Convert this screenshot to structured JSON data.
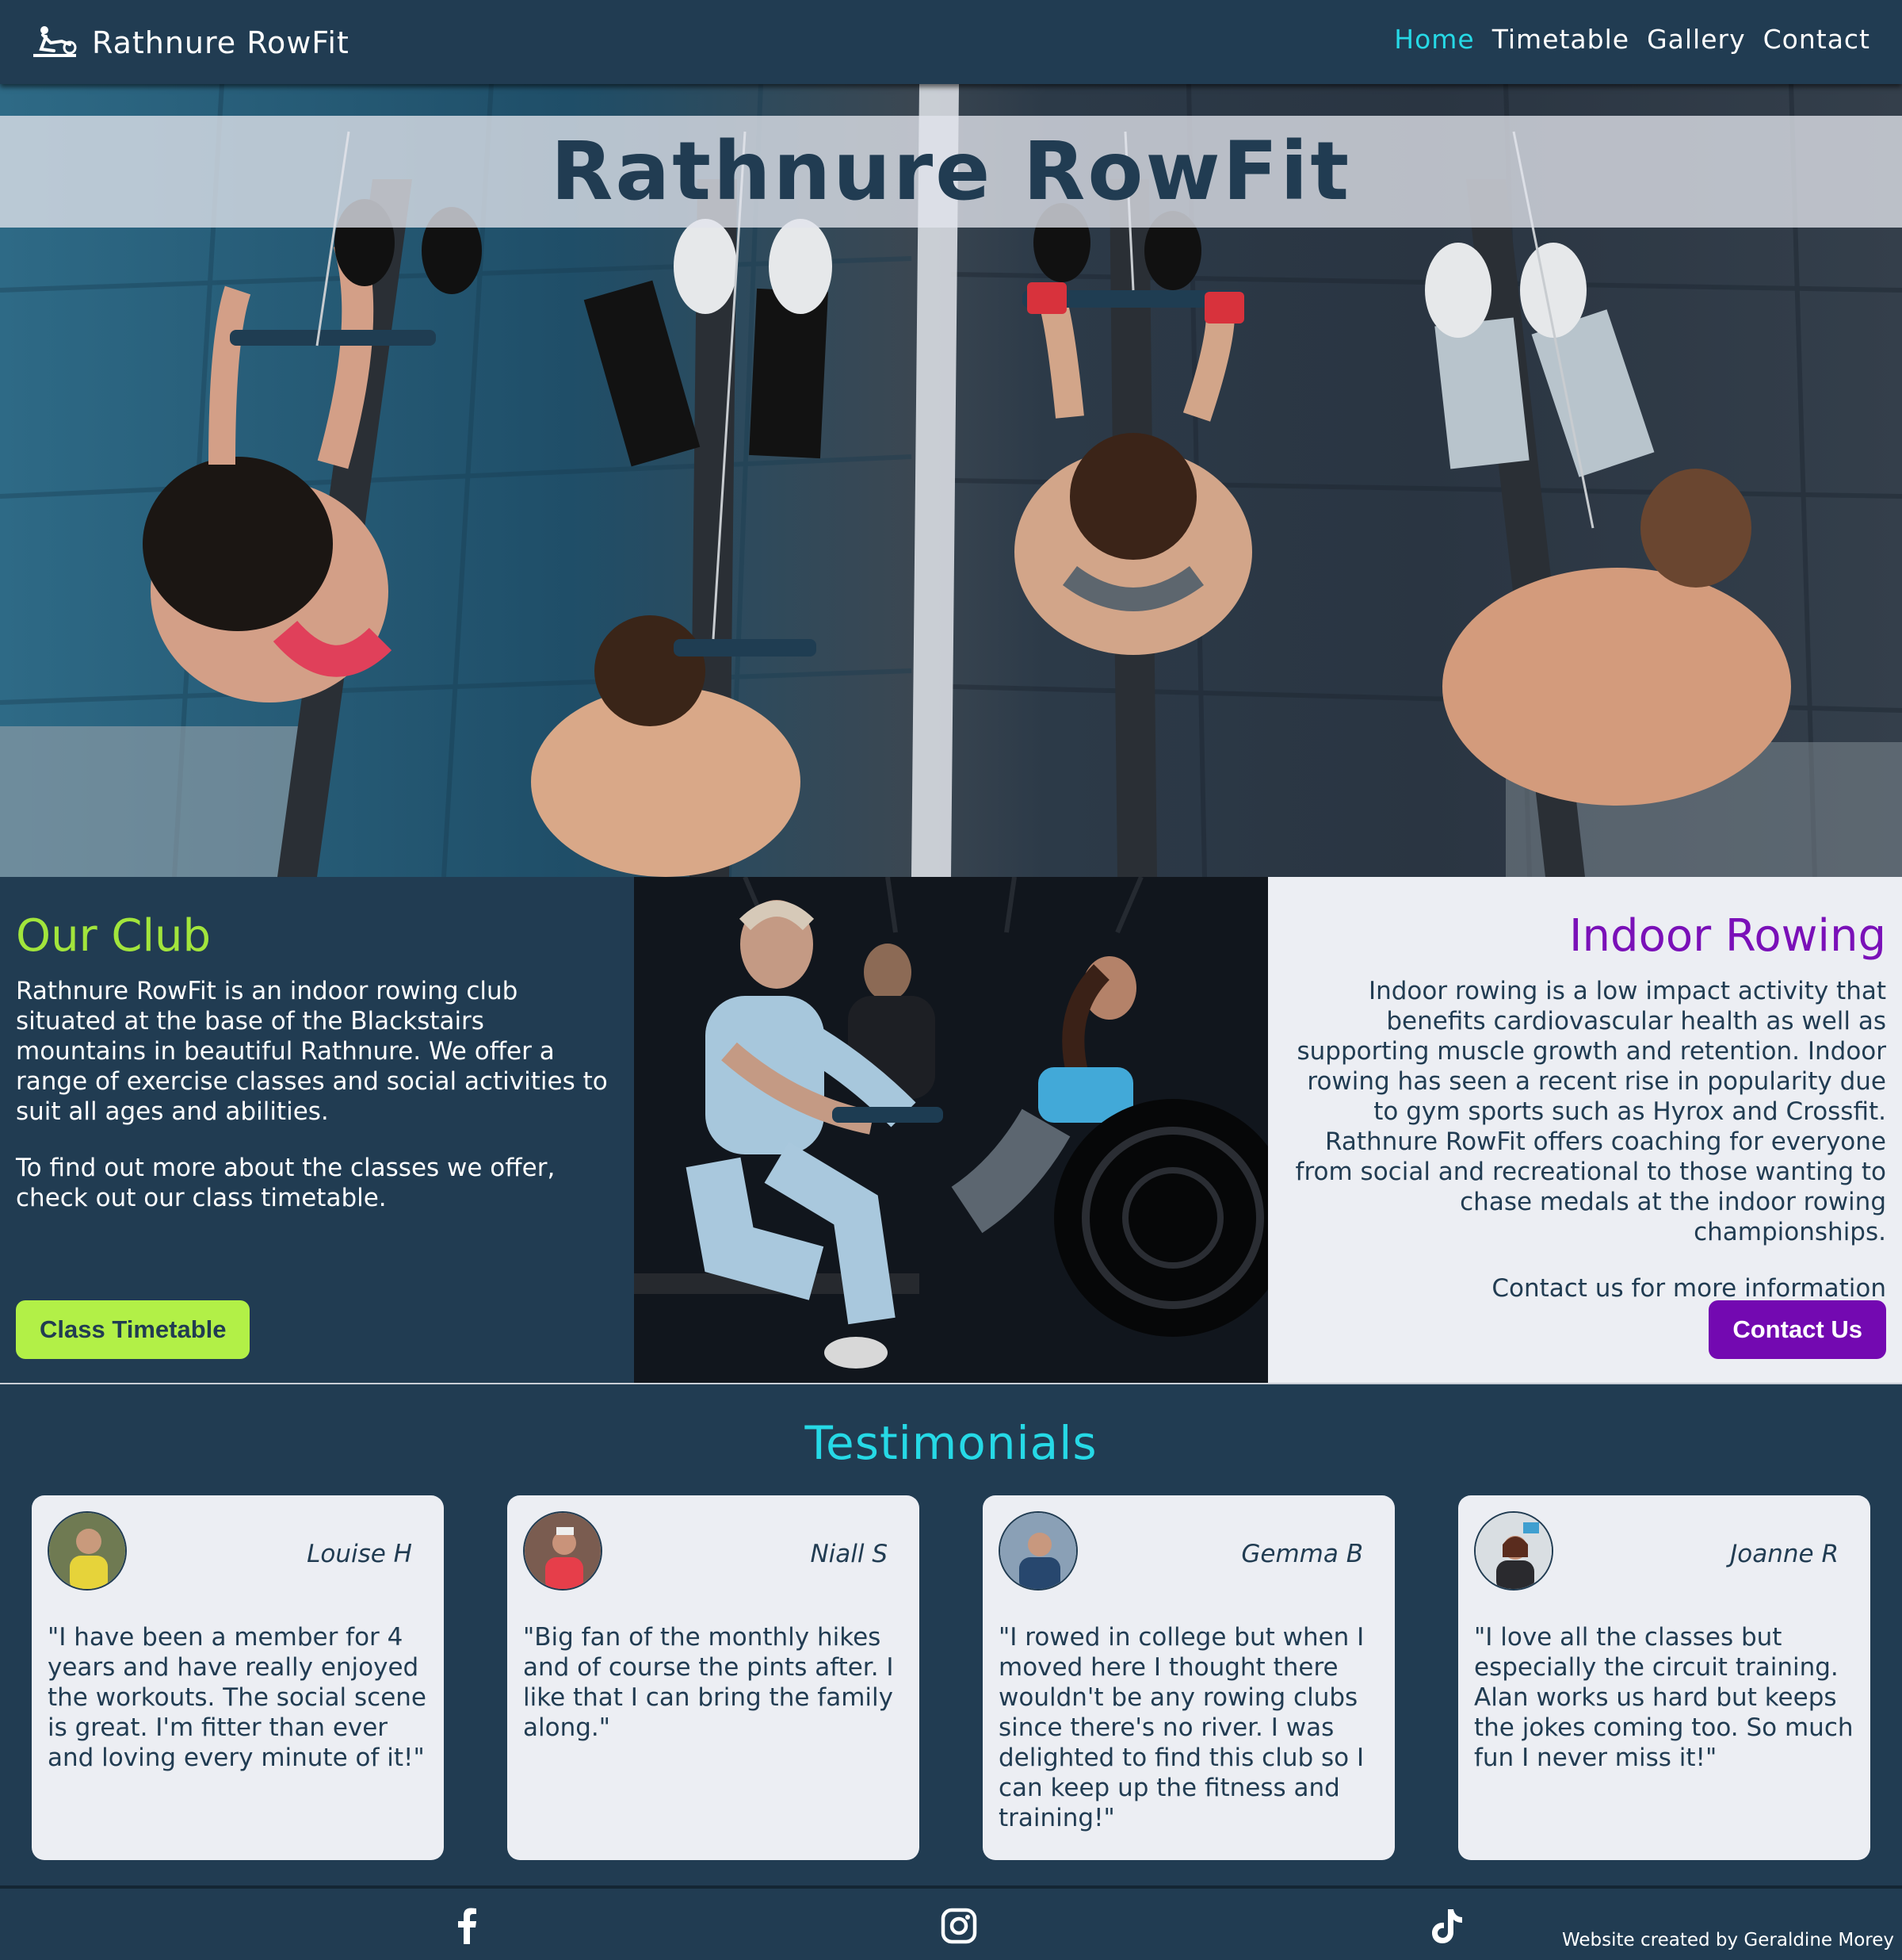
{
  "nav": {
    "brand": "Rathnure RowFit",
    "brand_icon": "rower-icon",
    "links": [
      "Home",
      "Timetable",
      "Gallery",
      "Contact"
    ],
    "active": "Home",
    "active_color": "#26d9e6"
  },
  "hero": {
    "title": "Rathnure RowFit"
  },
  "club": {
    "heading": "Our Club",
    "paragraph1": "Rathnure RowFit is an indoor rowing club situated at the base of the Blackstairs mountains in beautiful Rathnure. We offer a range of exercise classes and social activities to suit all ages and abilities.",
    "paragraph2": "To find out more about the classes we offer, check out our class timetable.",
    "button": "Class Timetable"
  },
  "rowing": {
    "heading": "Indoor Rowing",
    "paragraph1": "Indoor rowing is a low impact activity that benefits cardiovascular health as well as supporting muscle growth and retention. Indoor rowing has seen a recent rise in popularity due to gym sports such as Hyrox and Crossfit. Rathnure RowFit offers coaching for everyone from social and recreational to those wanting to chase medals at the indoor rowing championships.",
    "paragraph2": "Contact us for more information",
    "button": "Contact Us"
  },
  "testimonials": {
    "heading": "Testimonials",
    "items": [
      {
        "name": "Louise H",
        "quote": "\"I have been a member for 4 years and have really enjoyed the workouts. The social scene is great. I'm fitter than ever and loving every minute of it!\""
      },
      {
        "name": "Niall S",
        "quote": "\"Big fan of the monthly hikes and of course the pints after. I like that I can bring the family along.\""
      },
      {
        "name": "Gemma B",
        "quote": "\"I rowed in college but when I moved here I thought there wouldn't be any rowing clubs since there's no river. I was delighted to find this club so I can keep up the fitness and training!\""
      },
      {
        "name": "Joanne R",
        "quote": "\"I love all the classes but especially the circuit training. Alan works us hard but keeps the jokes coming too. So much fun I never miss it!\""
      }
    ]
  },
  "footer": {
    "icons": [
      "facebook-icon",
      "instagram-icon",
      "tiktok-icon"
    ],
    "credit": "Website created by Geraldine Morey"
  },
  "colors": {
    "navy": "#213c52",
    "lime": "#b2f047",
    "purple": "#7309b1",
    "cyan": "#26d9e6",
    "light": "#eceef3"
  }
}
